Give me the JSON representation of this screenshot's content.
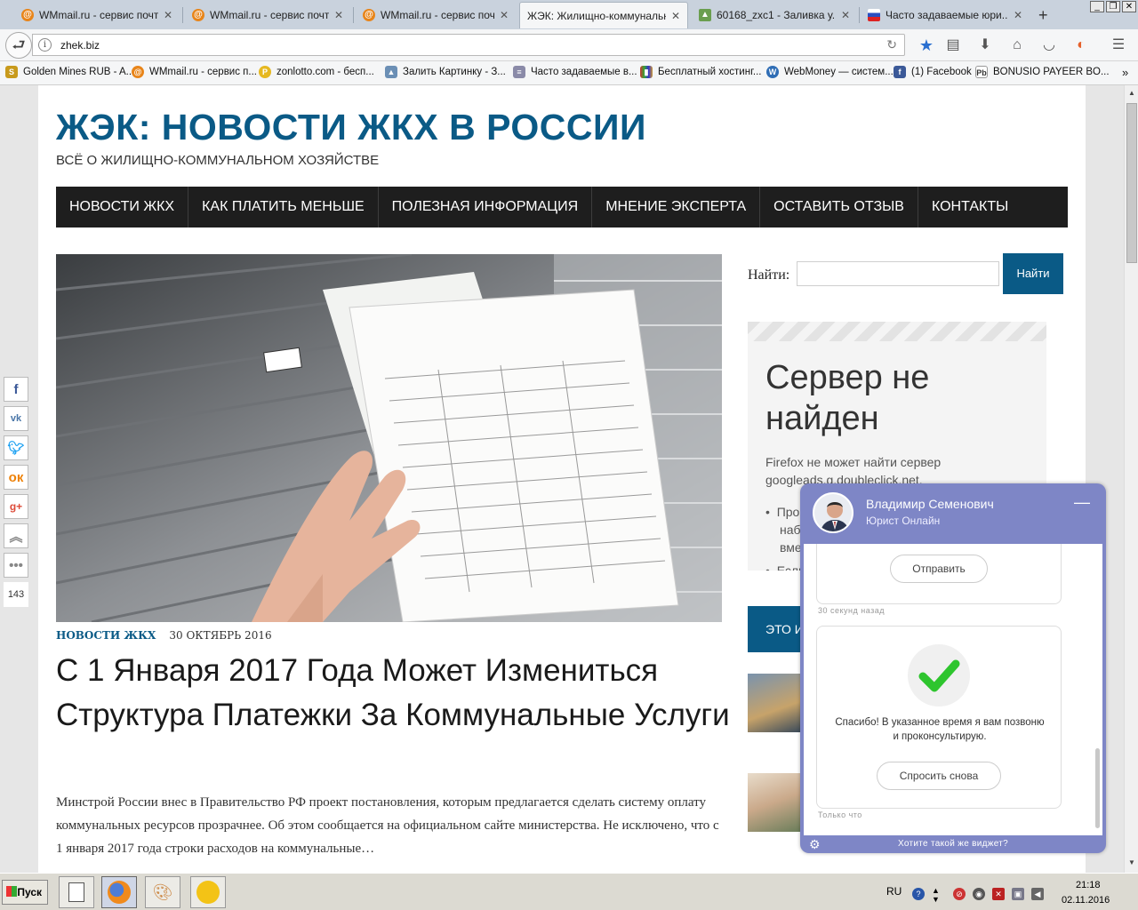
{
  "browser": {
    "tabs": [
      {
        "label": "WMmail.ru - сервис почт...",
        "icon": "at-icon"
      },
      {
        "label": "WMmail.ru - сервис почт...",
        "icon": "at-icon"
      },
      {
        "label": "WMmail.ru - сервис почт...",
        "icon": "at-icon"
      },
      {
        "label": "ЖЭК: Жилищно-коммунальн...",
        "icon": "page-icon",
        "active": true
      },
      {
        "label": "60168_zxc1 - Заливка у...",
        "icon": "image-icon"
      },
      {
        "label": "Часто задаваемые юри...",
        "icon": "flag-ru-icon"
      }
    ],
    "new_tab": "+",
    "url": "zhek.biz",
    "bookmarks": [
      {
        "label": "Golden Mines RUB - A...",
        "icon": "golden-mines-icon"
      },
      {
        "label": "WMmail.ru - сервис п...",
        "icon": "wmmail-icon"
      },
      {
        "label": "zonlotto.com - бесп...",
        "icon": "zonlotto-icon"
      },
      {
        "label": "Залить Картинку - З...",
        "icon": "upload-image-icon"
      },
      {
        "label": "Часто задаваемые в...",
        "icon": "faq-icon"
      },
      {
        "label": "Бесплатный хостинг...",
        "icon": "hosting-icon"
      },
      {
        "label": "WebMoney — систем...",
        "icon": "webmoney-icon"
      },
      {
        "label": "(1) Facebook",
        "icon": "facebook-icon"
      },
      {
        "label": "BONUSIO PAYEER BO...",
        "icon": "payeer-icon"
      }
    ]
  },
  "site": {
    "title": "ЖЭК: НОВОСТИ ЖКХ В РОССИИ",
    "description": "ВСЁ О ЖИЛИЩНО-КОММУНАЛЬНОМ ХОЗЯЙСТВЕ",
    "menu": [
      "НОВОСТИ ЖКХ",
      "КАК ПЛАТИТЬ МЕНЬШЕ",
      "ПОЛЕЗНАЯ ИНФОРМАЦИЯ",
      "МНЕНИЕ ЭКСПЕРТА",
      "ОСТАВИТЬ ОТЗЫВ",
      "КОНТАКТЫ"
    ]
  },
  "post": {
    "category": "НОВОСТИ ЖКХ",
    "date": "30 ОКТЯБРЬ 2016",
    "title": "С 1 Января 2017 Года Может Измениться Структура Платежки За Коммунальные Услуги",
    "excerpt": "Минстрой России внес в Правительство РФ проект постановления, которым предлагается сделать систему оплату коммунальных ресурсов прозрачнее. Об этом сообщается на официальном сайте министерства. Не исключено, что с 1 января 2017 года строки расходов на коммунальные…"
  },
  "sidebar": {
    "search_label": "Найти:",
    "search_placeholder": "",
    "search_button": "Найти",
    "error_title": "Сервер не найден",
    "error_text": "Firefox не может найти сервер googleads.g.doubleclick.net.",
    "error_items": [
      "Про",
      "наб",
      "вме",
      "Если"
    ],
    "widget_title": "ЭТО И"
  },
  "social": {
    "count": "143"
  },
  "chat": {
    "agent_name": "Владимир Семенович",
    "agent_role": "Юрист Онлайн",
    "send_button": "Отправить",
    "time_1": "30 секунд назад",
    "thanks": "Спасибо! В указанное время я вам позвоню и проконсультирую.",
    "ask_again": "Спросить снова",
    "time_2": "Только что",
    "footer": "Хотите такой же виджет?"
  },
  "taskbar": {
    "start": "Пуск",
    "lang": "RU",
    "time": "21:18",
    "date": "02.11.2016"
  }
}
